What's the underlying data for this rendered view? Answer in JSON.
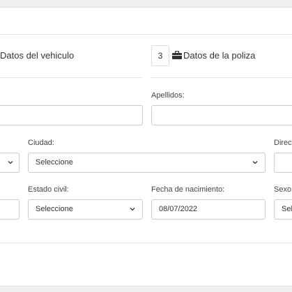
{
  "steps": [
    {
      "label": "Datos del vehiculo"
    },
    {
      "number": "3",
      "label": "Datos de la poliza"
    }
  ],
  "form": {
    "apellidos_label": "Apellidos:",
    "ciudad_label": "Ciudad:",
    "ciudad_value": "Seleccione",
    "direccion_label": "Direcc",
    "estado_civil_label": "Estado civil:",
    "estado_civil_value": "Seleccione",
    "fecha_nacimiento_label": "Fecha de nacimiento:",
    "fecha_nacimiento_value": "08/07/2022",
    "sexo_label": "Sexo:",
    "sexo_value": "Sel"
  },
  "icons": {
    "briefcase": "briefcase-icon",
    "chevron": "chevron-down-icon"
  }
}
